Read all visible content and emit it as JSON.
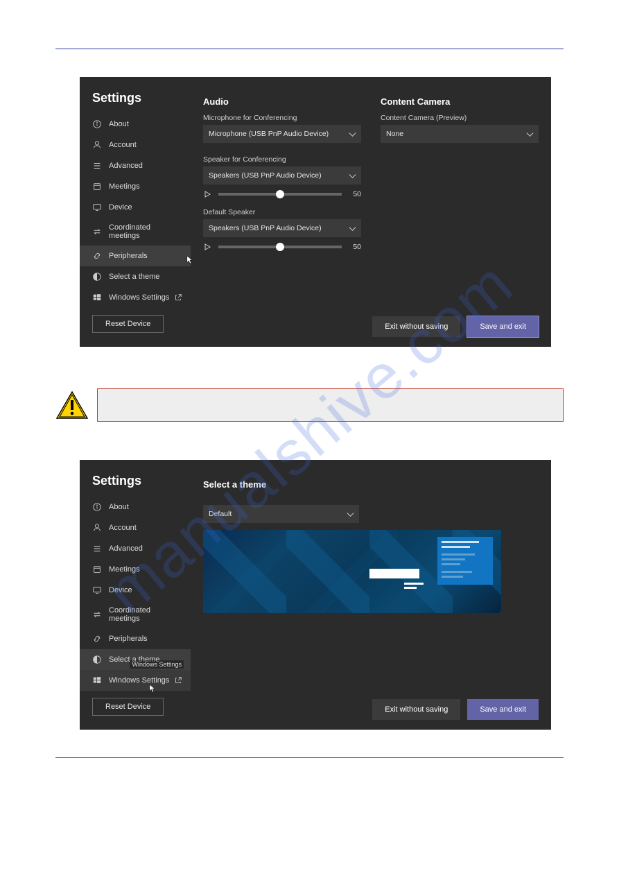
{
  "watermark": "manualshive.com",
  "panel1": {
    "title": "Settings",
    "nav": [
      {
        "label": "About"
      },
      {
        "label": "Account"
      },
      {
        "label": "Advanced"
      },
      {
        "label": "Meetings"
      },
      {
        "label": "Device"
      },
      {
        "label": "Coordinated meetings"
      },
      {
        "label": "Peripherals"
      },
      {
        "label": "Select a theme"
      },
      {
        "label": "Windows Settings"
      }
    ],
    "selected_index": 6,
    "reset": "Reset Device",
    "audio": {
      "section": "Audio",
      "mic_label": "Microphone for Conferencing",
      "mic_value": "Microphone (USB PnP Audio Device)",
      "spk_label": "Speaker for Conferencing",
      "spk_value": "Speakers (USB PnP Audio Device)",
      "spk_volume": "50",
      "def_label": "Default Speaker",
      "def_value": "Speakers (USB PnP Audio Device)",
      "def_volume": "50"
    },
    "camera": {
      "section": "Content Camera",
      "label": "Content Camera (Preview)",
      "value": "None"
    },
    "actions": {
      "exit": "Exit without saving",
      "save": "Save and exit"
    }
  },
  "panel2": {
    "title": "Settings",
    "nav": [
      {
        "label": "About"
      },
      {
        "label": "Account"
      },
      {
        "label": "Advanced"
      },
      {
        "label": "Meetings"
      },
      {
        "label": "Device"
      },
      {
        "label": "Coordinated meetings"
      },
      {
        "label": "Peripherals"
      },
      {
        "label": "Select a theme"
      },
      {
        "label": "Windows Settings"
      }
    ],
    "selected_index": 7,
    "hovered_index": 8,
    "tooltip": "Windows Settings",
    "reset": "Reset Device",
    "theme": {
      "section": "Select a theme",
      "value": "Default"
    },
    "actions": {
      "exit": "Exit without saving",
      "save": "Save and exit"
    }
  }
}
